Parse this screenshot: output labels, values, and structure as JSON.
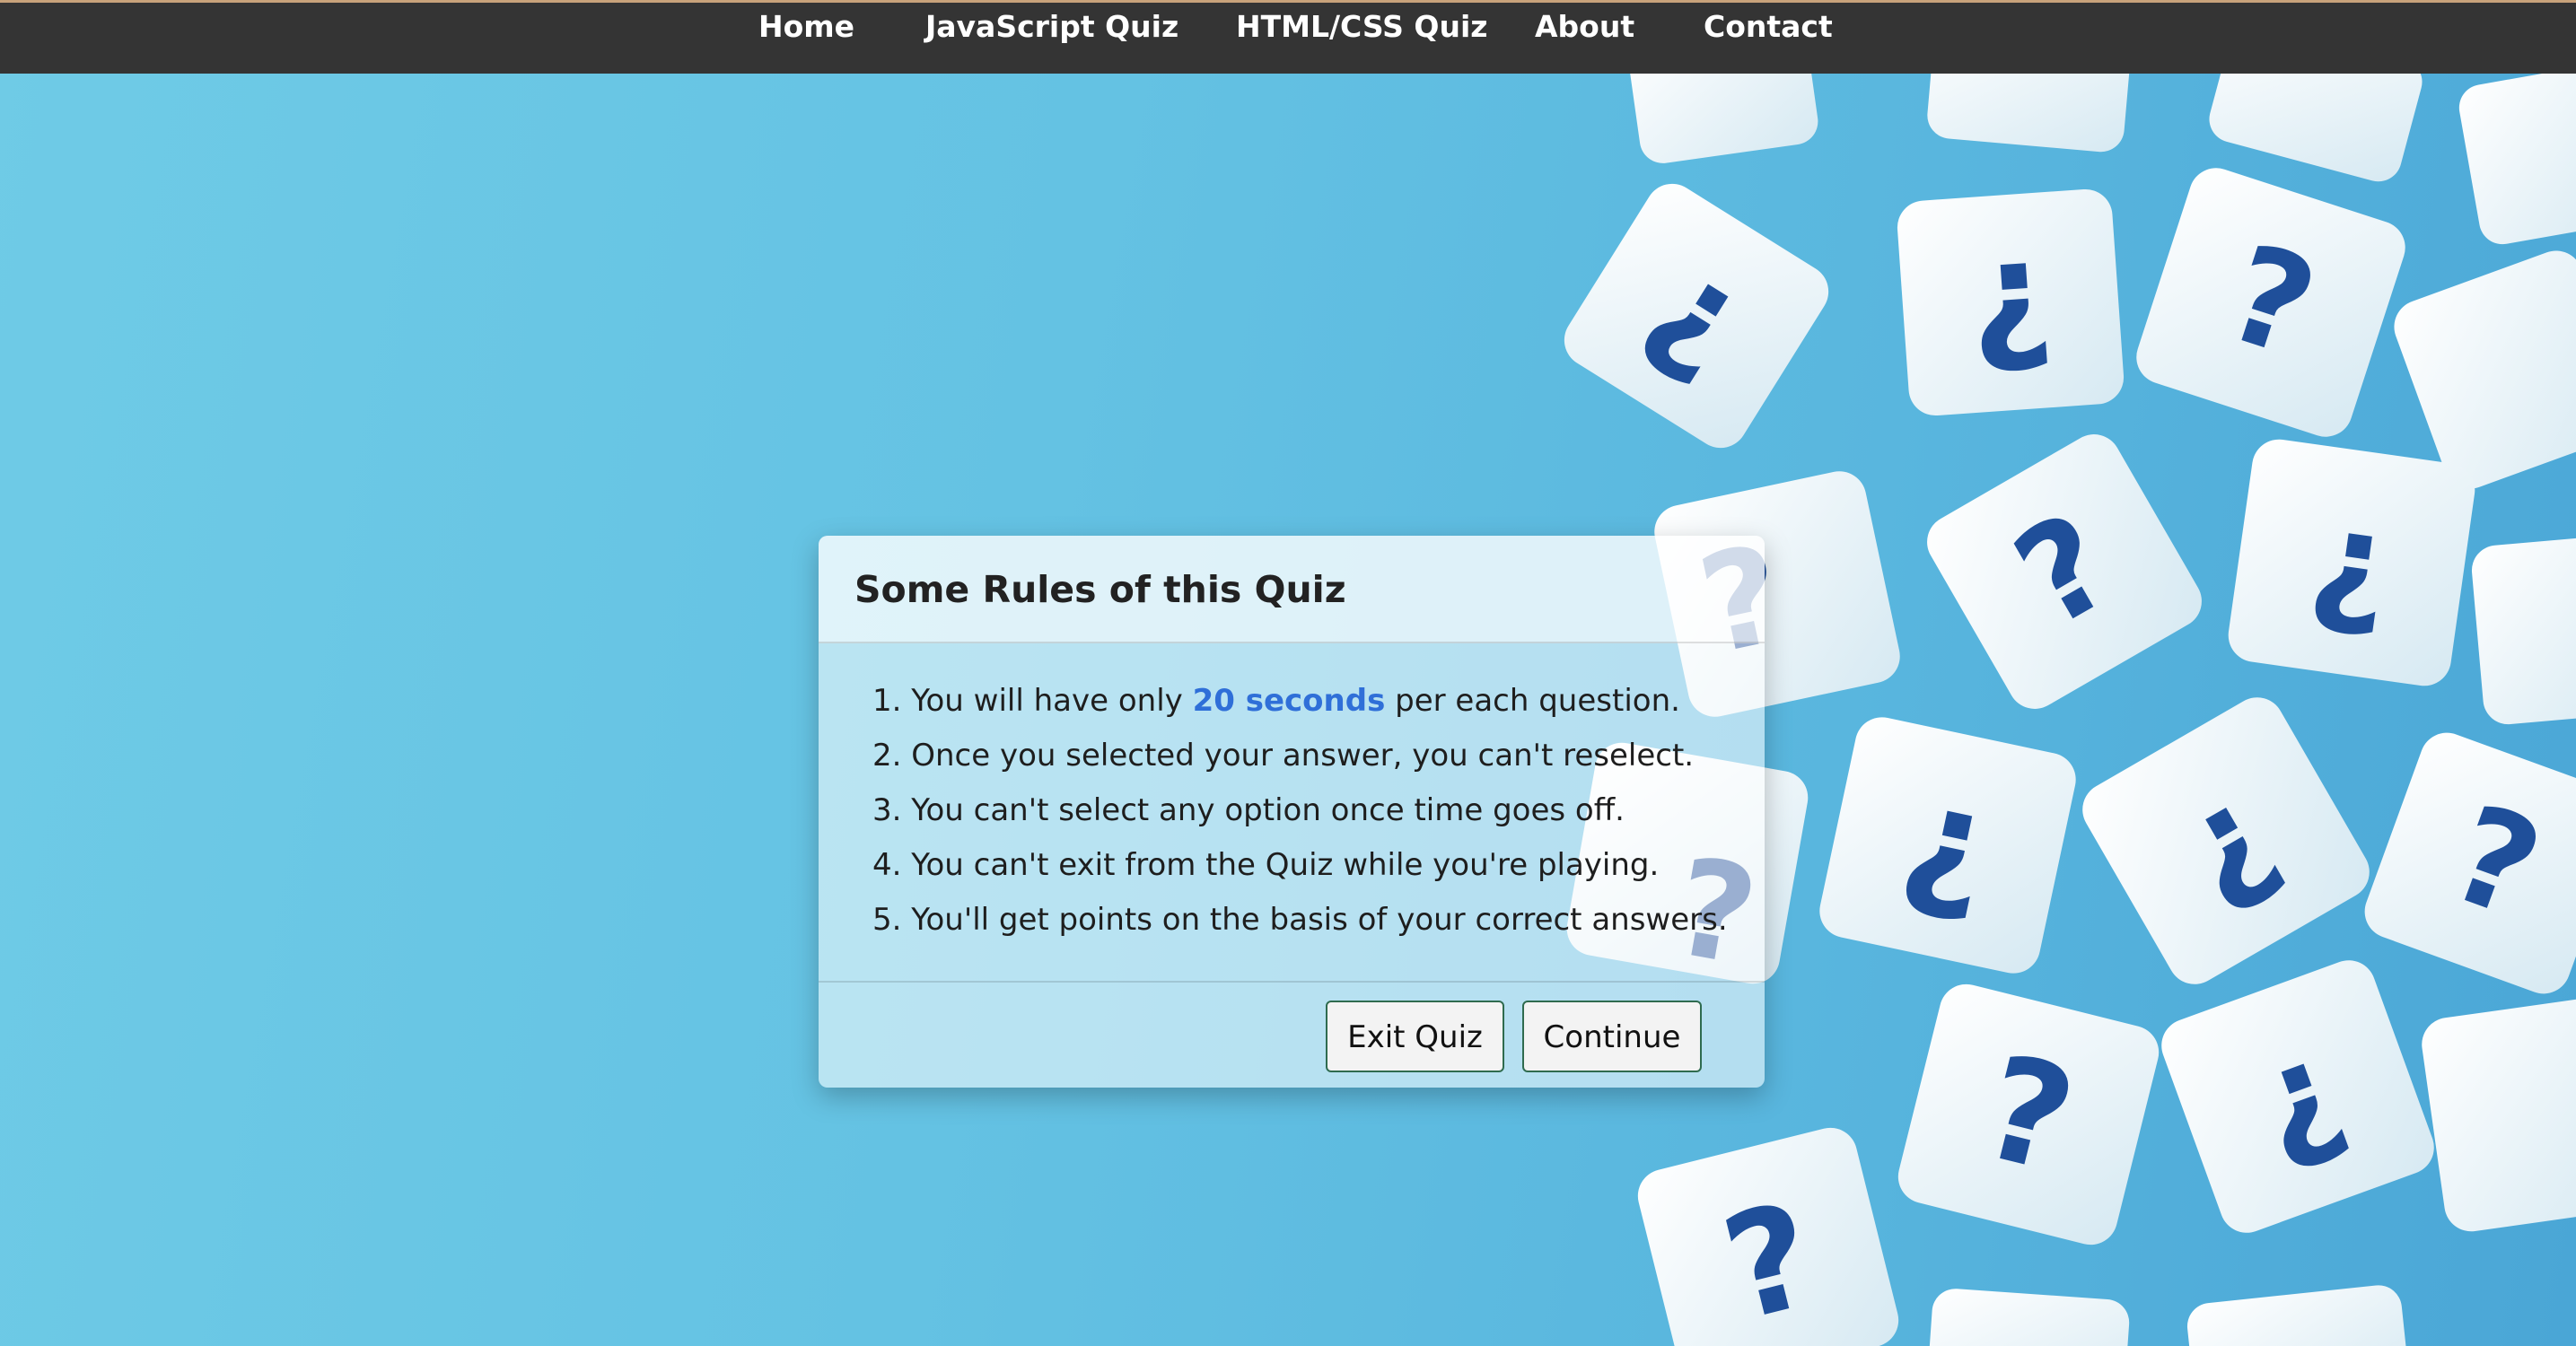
{
  "nav": {
    "items": [
      {
        "label": "Home"
      },
      {
        "label": "JavaScript Quiz"
      },
      {
        "label": "HTML/CSS Quiz"
      },
      {
        "label": "About"
      },
      {
        "label": "Contact"
      }
    ]
  },
  "modal": {
    "title": "Some Rules of this Quiz",
    "rules": [
      {
        "prefix": "1. You will have only ",
        "highlight": "20 seconds",
        "suffix": " per each question."
      },
      {
        "text": "2. Once you selected your answer, you can't reselect."
      },
      {
        "text": "3. You can't select any option once time goes off."
      },
      {
        "text": "4. You can't exit from the Quiz while you're playing."
      },
      {
        "text": "5. You'll get points on the basis of your correct answers."
      }
    ],
    "exit_label": "Exit Quiz",
    "continue_label": "Continue"
  },
  "colors": {
    "nav_bg": "#343434",
    "highlight": "#2f6fd8",
    "background": "#64c2e3"
  }
}
